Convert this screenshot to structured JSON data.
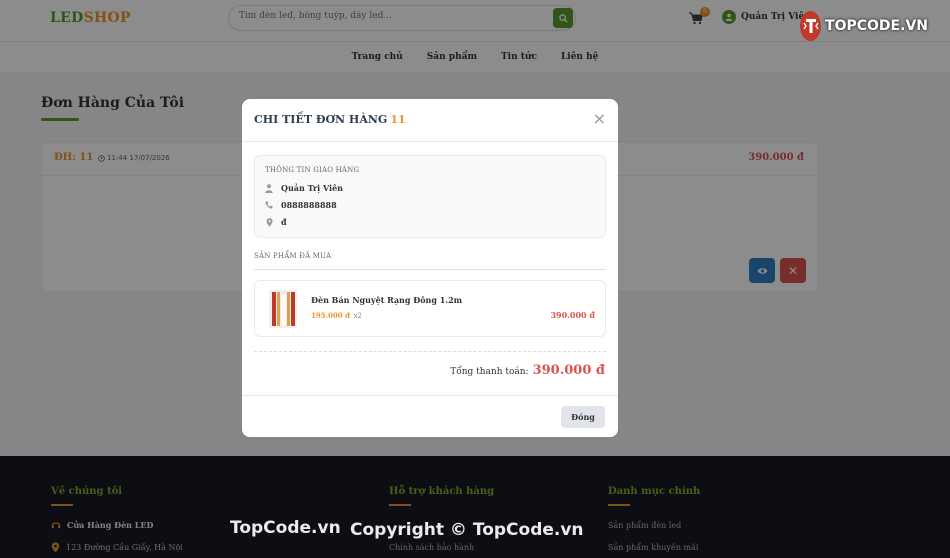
{
  "header": {
    "logo_part1": "LED",
    "logo_part2": "SHOP",
    "search_placeholder": "Tìm đèn led, bóng tuýp, dây led...",
    "cart_count": "0",
    "user_name": "Quản Trị Viên",
    "nav": [
      "Trang chủ",
      "Sản phẩm",
      "Tin tức",
      "Liên hệ"
    ]
  },
  "watermark_badge": {
    "text": "TOPCODE.VN"
  },
  "page": {
    "title": "Đơn Hàng Của Tôi",
    "order": {
      "code": "ĐH: 11",
      "date": "11:44 17/07/2026",
      "total": "390.000 đ"
    }
  },
  "modal": {
    "title": "CHI TIẾT ĐƠN HÀNG",
    "order_number": "11",
    "shipping_label": "THÔNG TIN GIAO HÀNG",
    "recipient": "Quản Trị Viên",
    "phone": "0888888888",
    "address": "đ",
    "products_label": "SẢN PHẨM ĐÃ MUA",
    "product": {
      "name": "Đèn Bán Nguyệt Rạng Đông 1.2m",
      "price": "195.000 đ",
      "qty": "x2",
      "subtotal": "390.000 đ"
    },
    "total_label": "Tổng thanh toán:",
    "total_value": "390.000 đ",
    "close_label": "Đóng"
  },
  "footer": {
    "col1_title": "Về chúng tôi",
    "store_name": "Cửa Hàng Đèn LED",
    "address": "123 Đường Cầu Giấy, Hà Nội",
    "col2_title": "Hỗ trợ khách hàng",
    "col2_link": "Chính sách bảo hành",
    "col3_title": "Danh mục chính",
    "col3_links": [
      "Sản phẩm đèn led",
      "Sản phẩm khuyến mãi"
    ]
  },
  "watermarks": [
    "TopCode.vn",
    "Copyright © TopCode.vn"
  ],
  "colors": {
    "brand_green": "#5a9a2a",
    "brand_orange": "#e8962a",
    "price_red": "#d9534f",
    "footer_bg": "#161a24"
  }
}
